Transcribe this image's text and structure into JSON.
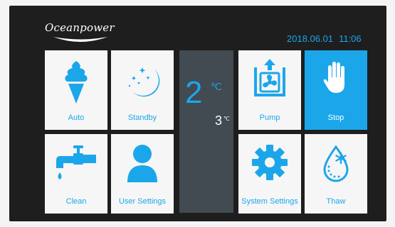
{
  "brand": {
    "name": "Oceanpower"
  },
  "header": {
    "date": "2018.06.01",
    "time": "11:06"
  },
  "temperature": {
    "main_value": "2",
    "main_unit": "℃",
    "sub_value": "3",
    "sub_unit": "℃"
  },
  "tiles": {
    "auto": {
      "label": "Auto",
      "icon": "ice-cream-icon"
    },
    "standby": {
      "label": "Standby",
      "icon": "moon-stars-icon"
    },
    "pump": {
      "label": "Pump",
      "icon": "fan-pump-icon"
    },
    "stop": {
      "label": "Stop",
      "icon": "hand-icon",
      "active": true
    },
    "clean": {
      "label": "Clean",
      "icon": "faucet-icon"
    },
    "user_settings": {
      "label": "User Settings",
      "icon": "user-icon"
    },
    "system_settings": {
      "label": "System Settings",
      "icon": "gear-icon"
    },
    "thaw": {
      "label": "Thaw",
      "icon": "thaw-drop-icon"
    }
  },
  "colors": {
    "accent": "#1ca6ea",
    "background": "#1e1e1e",
    "tile": "#f6f6f6",
    "temp_panel": "#424a52",
    "active_tile": "#1ca6ea"
  }
}
